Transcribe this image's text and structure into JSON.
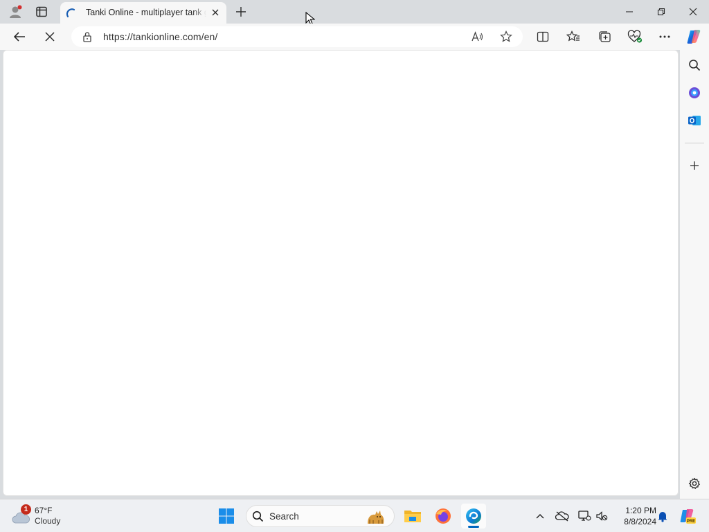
{
  "browser": {
    "tab": {
      "title": "Tanki Online - multiplayer tank game",
      "loading": true
    },
    "address_bar": {
      "url": "https://tankionline.com/en/"
    },
    "icons": {
      "profile": "profile-icon",
      "tab_actions": "tab-actions-icon",
      "new_tab": "plus-icon",
      "back": "back-arrow-icon",
      "stop": "stop-loading-icon",
      "site_info": "lock-icon",
      "read_aloud": "read-aloud-icon",
      "favorite": "star-icon",
      "split_screen": "split-screen-icon",
      "favorites": "favorites-icon",
      "collections": "collections-icon",
      "browser_essentials": "heart-pulse-icon",
      "more": "more-icon",
      "copilot": "copilot-icon"
    },
    "window_controls": [
      "minimize",
      "restore",
      "close"
    ]
  },
  "sidebar": {
    "items": [
      "search-icon",
      "copilot-app-icon",
      "outlook-icon",
      "add-icon",
      "settings-icon"
    ]
  },
  "taskbar": {
    "weather": {
      "temperature": "67°F",
      "condition": "Cloudy",
      "badge": "1"
    },
    "search": {
      "label": "Search"
    },
    "apps": [
      "windows-start",
      "file-explorer",
      "firefox",
      "edge"
    ],
    "clock": {
      "time": "1:20 PM",
      "date": "8/8/2024"
    }
  },
  "colors": {
    "accent": "#0067c0",
    "chrome_bg": "#d9dcdf",
    "toolbar_bg": "#f7f7f7",
    "badge_red": "#c42b1c"
  }
}
